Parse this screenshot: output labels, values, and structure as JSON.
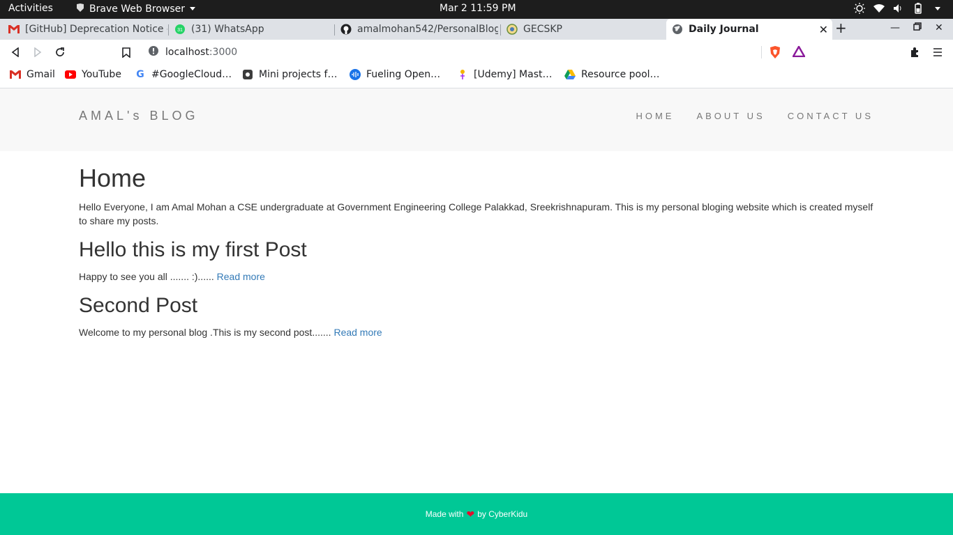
{
  "system_bar": {
    "activities": "Activities",
    "app_name": "Brave Web Browser",
    "clock": "Mar 2  11:59 PM"
  },
  "tabs": [
    {
      "title": "[GitHub] Deprecation Notice -",
      "icon": "gmail-icon"
    },
    {
      "title": "(31) WhatsApp",
      "icon": "whatsapp-icon"
    },
    {
      "title": "amalmohan542/PersonalBlog",
      "icon": "github-icon"
    },
    {
      "title": "GECSKP",
      "icon": "college-logo-icon"
    },
    {
      "title": "Daily Journal",
      "icon": "globe-icon",
      "active": true
    }
  ],
  "omnibox": {
    "host": "localhost",
    "port": ":3000"
  },
  "bookmarks": [
    {
      "label": "Gmail",
      "icon": "gmail-icon"
    },
    {
      "label": "YouTube",
      "icon": "youtube-icon"
    },
    {
      "label": "#GoogleCloud…",
      "icon": "google-icon"
    },
    {
      "label": "Mini projects f…",
      "icon": "shield-icon"
    },
    {
      "label": "Fueling Open…",
      "icon": "audio-wave-icon"
    },
    {
      "label": "[Udemy] Mast…",
      "icon": "udemy-icon"
    },
    {
      "label": "Resource pool…",
      "icon": "google-drive-icon"
    }
  ],
  "site": {
    "brand": "AMAL's BLOG",
    "nav": [
      "HOME",
      "ABOUT US",
      "CONTACT US"
    ],
    "heading": "Home",
    "intro": "Hello Everyone, I am Amal Mohan a CSE undergraduate at Government Engineering College Palakkad, Sreekrishnapuram. This is my personal bloging website which is created myself to share my posts.",
    "posts": [
      {
        "title": "Hello this is my first Post",
        "excerpt": "Happy to see you all ....... :)...... ",
        "link": "Read more"
      },
      {
        "title": "Second Post",
        "excerpt": "Welcome to my personal blog .This is my second post....... ",
        "link": "Read more"
      }
    ],
    "footer": {
      "prefix": "Made with",
      "suffix": "by CyberKidu"
    }
  },
  "colors": {
    "accent_footer": "#00c896",
    "link": "#337ab7",
    "heart": "#e0102f"
  }
}
